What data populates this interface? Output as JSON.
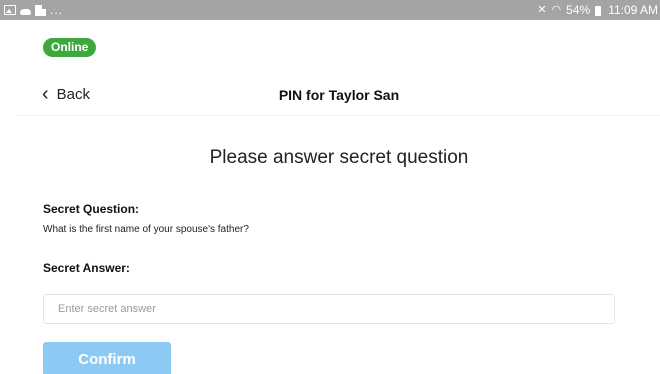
{
  "status_bar": {
    "notification_icons": [
      "image-icon",
      "cloud-icon",
      "note-icon"
    ],
    "overflow_text": "...",
    "battery_text": "54%",
    "time": "11:09 AM",
    "color": "#a4a4a4"
  },
  "connection": {
    "status_label": "Online",
    "color": "#3ea83e"
  },
  "nav": {
    "back_label": "Back",
    "title": "PIN for Taylor San"
  },
  "form": {
    "heading": "Please answer secret question",
    "question_label": "Secret Question:",
    "question_text": "What is the first name of your spouse's father?",
    "answer_label": "Secret Answer:",
    "answer_value": "",
    "answer_placeholder": "Enter secret answer",
    "confirm_label": "Confirm",
    "confirm_color": "#8cc9f3"
  }
}
